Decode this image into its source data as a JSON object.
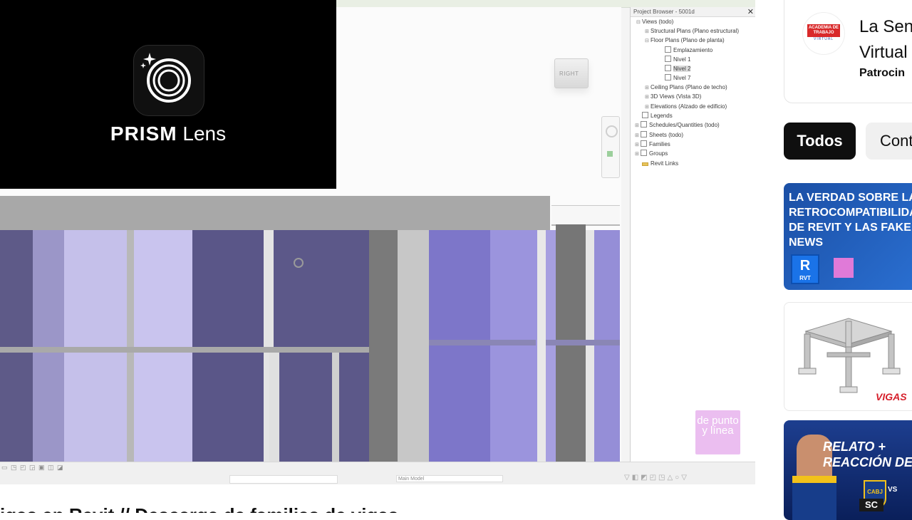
{
  "overlay": {
    "brand_bold": "PRISM",
    "brand_light": "Lens"
  },
  "revit": {
    "viewcube_label": "RIGHT",
    "project_browser": {
      "title": "Project Browser - 5001d",
      "close": "✕",
      "items": [
        {
          "label": "Views (todo)",
          "level": 0
        },
        {
          "label": "Structural Plans (Plano estructural)",
          "level": 1
        },
        {
          "label": "Floor Plans (Plano de planta)",
          "level": 1
        },
        {
          "label": "Emplazamiento",
          "level": 2
        },
        {
          "label": "Nivel 1",
          "level": 2
        },
        {
          "label": "Nivel 2",
          "level": 2
        },
        {
          "label": "Nivel 7",
          "level": 2
        },
        {
          "label": "Ceiling Plans (Plano de techo)",
          "level": 1
        },
        {
          "label": "3D Views (Vista 3D)",
          "level": 1
        },
        {
          "label": "Elevations (Alzado de edificio)",
          "level": 1
        },
        {
          "label": "Legends",
          "level": 0
        },
        {
          "label": "Schedules/Quantities (todo)",
          "level": 0
        },
        {
          "label": "Sheets (todo)",
          "level": 0
        },
        {
          "label": "Families",
          "level": 0
        },
        {
          "label": "Groups",
          "level": 0
        },
        {
          "label": "Revit Links",
          "level": 0
        }
      ]
    },
    "statusbar": {
      "model": "Main Model"
    },
    "watermark": "de punto y línea"
  },
  "video": {
    "title": "igas en Revit // Descarga de familias de vigas"
  },
  "ad": {
    "logo_line1": "ACADEMIA DE TRABAJO",
    "logo_line2": "VIRTUAL",
    "title_line1": "La Sen",
    "title_line2": "Virtual",
    "sponsor": "Patrocin"
  },
  "chips": {
    "all": "Todos",
    "second": "Cont"
  },
  "recommendations": [
    {
      "text_lines": [
        "LA VERDAD SOBRE LA",
        "RETROCOMPATIBILIDA",
        "DE REVIT Y LAS FAKE",
        "NEWS"
      ],
      "badge": "R",
      "badge_sub": "RVT"
    },
    {
      "label": "VIGAS"
    },
    {
      "text_lines": [
        "RELATO +",
        "REACCIÓN DE LOS H"
      ],
      "badge": "CABJ",
      "vs": "VS",
      "sc": "SC"
    }
  ]
}
